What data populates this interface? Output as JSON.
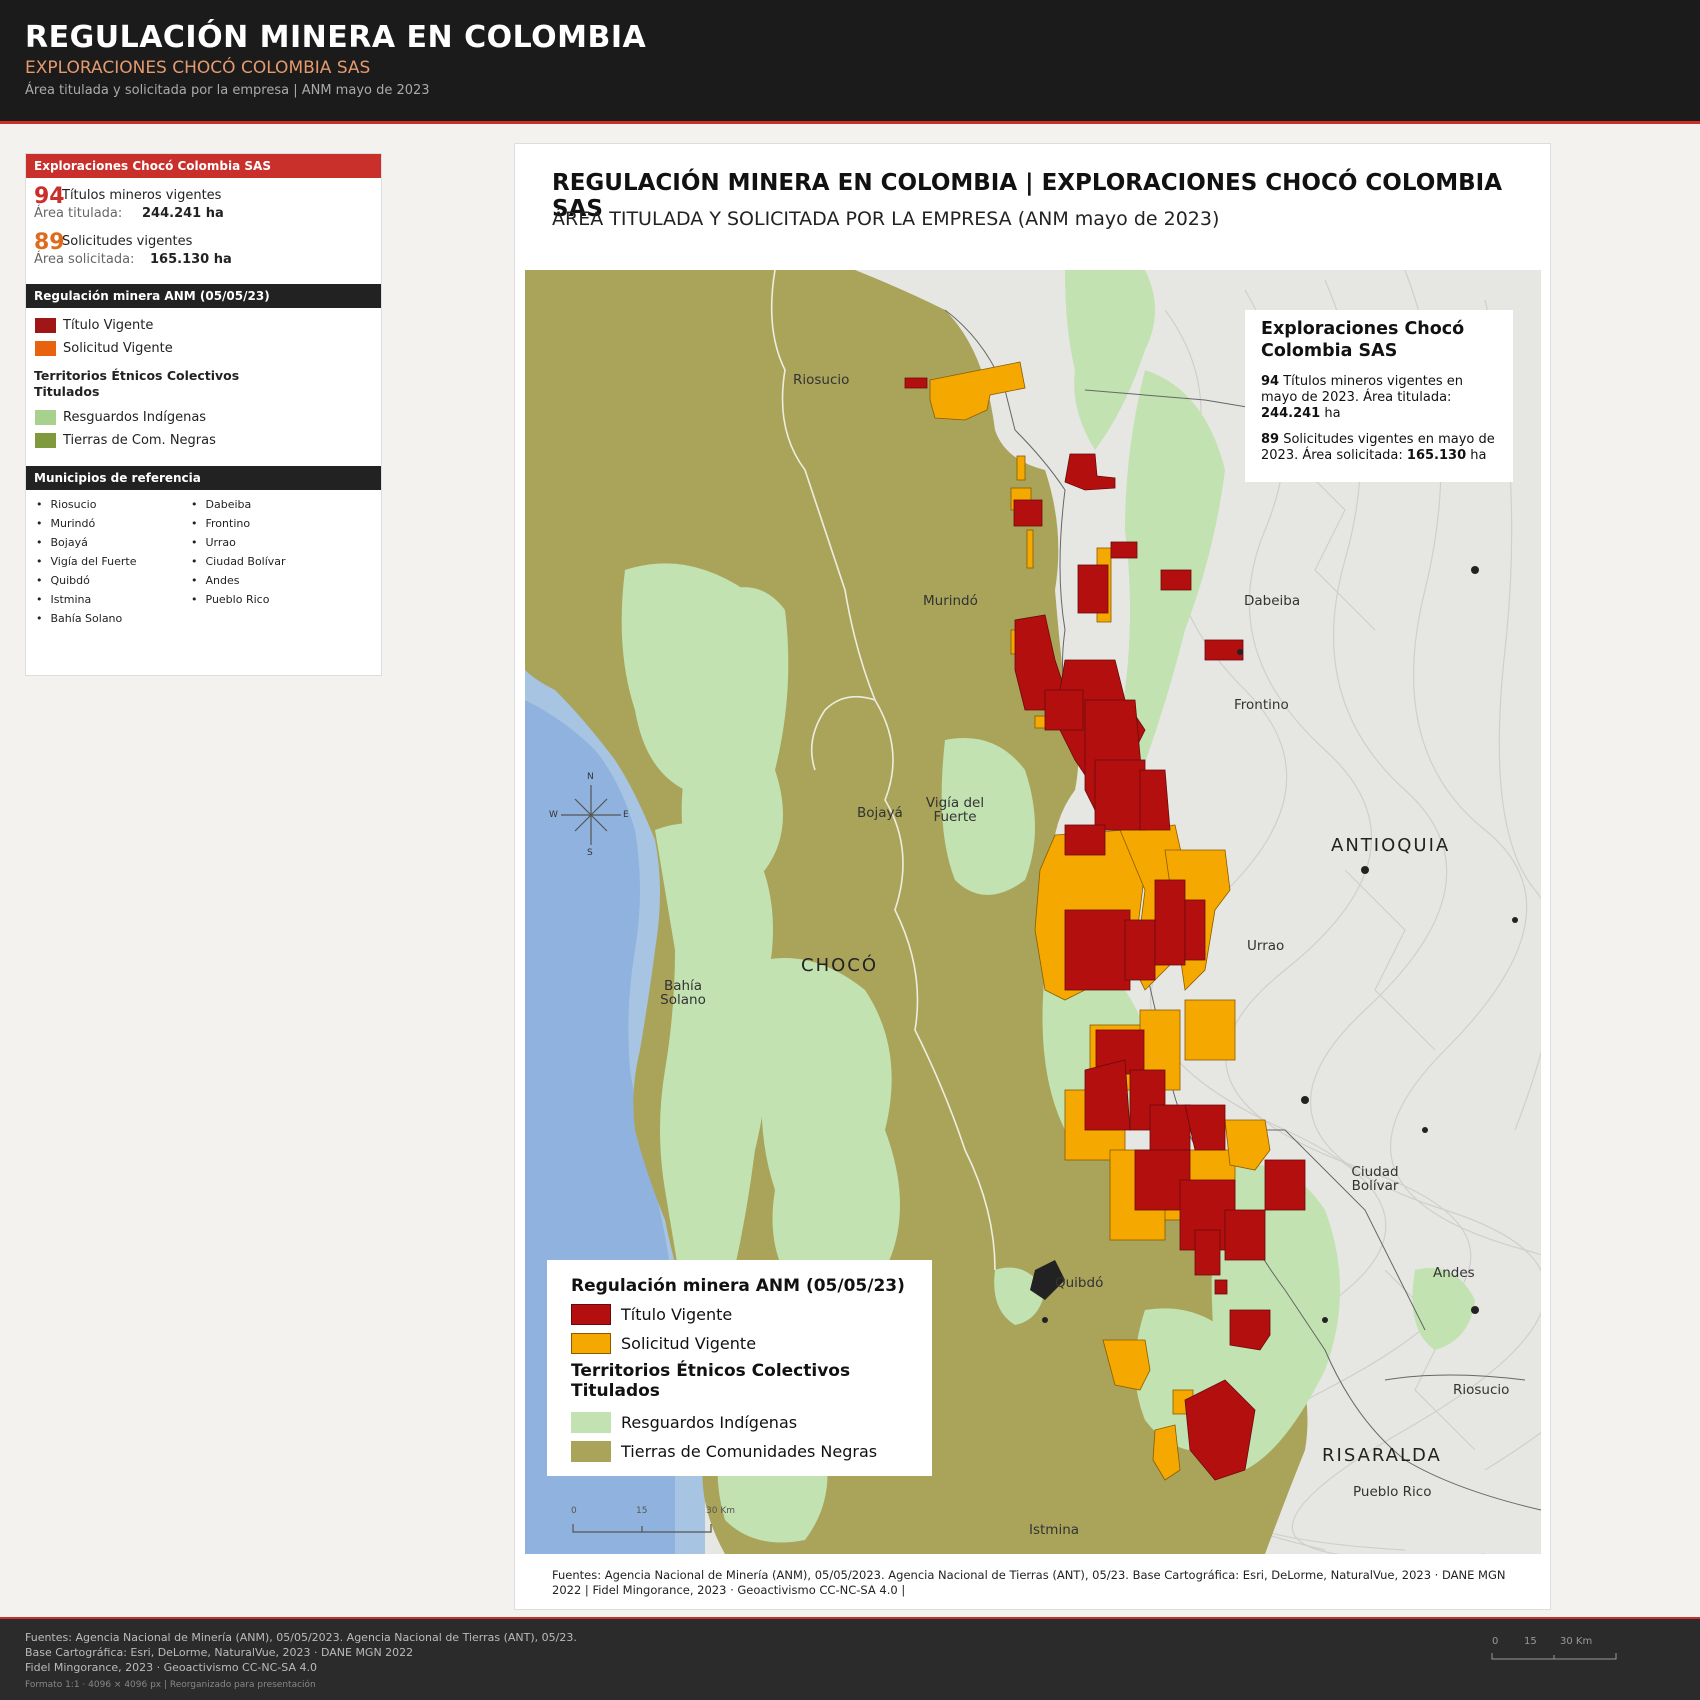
{
  "header": {
    "title": "REGULACIÓN MINERA EN COLOMBIA",
    "subtitle": "EXPLORACIONES CHOCÓ COLOMBIA SAS",
    "meta": "Área titulada y solicitada por la empresa  |  ANM mayo de 2023"
  },
  "sidebar": {
    "company_header": "Exploraciones Chocó Colombia SAS",
    "stats": [
      {
        "number": "94",
        "label": "Títulos mineros vigentes",
        "area_label": "Área titulada:",
        "area_value": "244.241 ha",
        "color": "#c9302c"
      },
      {
        "number": "89",
        "label": "Solicitudes vigentes",
        "area_label": "Área solicitada:",
        "area_value": "165.130 ha",
        "color": "#e06a1b"
      }
    ],
    "regulation_header": "Regulación minera ANM (05/05/23)",
    "regulation_items": [
      {
        "label": "Título Vigente",
        "color": "#a01515"
      },
      {
        "label": "Solicitud Vigente",
        "color": "#e8620f"
      }
    ],
    "ethnic_header": "Territorios Étnicos Colectivos Titulados",
    "ethnic_items": [
      {
        "label": "Resguardos Indígenas",
        "color": "#a9d18e"
      },
      {
        "label": "Tierras de Com. Negras",
        "color": "#7f9a3d"
      }
    ],
    "municipios_header": "Municipios de referencia",
    "municipios_col1": [
      "Riosucio",
      "Murindó",
      "Bojayá",
      "Vigía del Fuerte",
      "Quibdó",
      "Istmina",
      "Bahía Solano"
    ],
    "municipios_col2": [
      "Dabeiba",
      "Frontino",
      "Urrao",
      "Ciudad Bolívar",
      "Andes",
      "Pueblo Rico"
    ]
  },
  "map_card": {
    "title": "REGULACIÓN MINERA EN COLOMBIA | EXPLORACIONES CHOCÓ COLOMBIA SAS",
    "subtitle": "ÁREA TITULADA Y SOLICITADA POR LA EMPRESA (ANM mayo de 2023)",
    "info_box": {
      "title": "Exploraciones Chocó Colombia SAS",
      "p1_num": "94",
      "p1_text": " Títulos mineros vigentes en mayo de 2023. Área titulada: ",
      "p1_val": "244.241",
      "p1_unit": " ha",
      "p2_num": "89",
      "p2_text": " Solicitudes vigentes en mayo de 2023. Área solicitada: ",
      "p2_val": "165.130",
      "p2_unit": " ha"
    },
    "legend": {
      "title": "Regulación minera ANM (05/05/23)",
      "items": [
        {
          "label": "Título Vigente",
          "color": "#b30f0f"
        },
        {
          "label": "Solicitud Vigente",
          "color": "#f5a800"
        }
      ],
      "title2": "Territorios Étnicos Colectivos Titulados",
      "items2": [
        {
          "label": "Resguardos Indígenas",
          "color": "#c2e2b2"
        },
        {
          "label": "Tierras de Comunidades Negras",
          "color": "#a9a45a"
        }
      ]
    },
    "places": [
      "Riosucio",
      "Murindó",
      "Dabeiba",
      "Frontino",
      "Bojayá",
      "Vigía del Fuerte",
      "Urrao",
      "Bahía Solano",
      "Ciudad Bolívar",
      "Quibdó",
      "Andes",
      "Riosucio",
      "Pueblo Rico",
      "Istmina"
    ],
    "departments": [
      "CHOCÓ",
      "ANTIOQUIA",
      "RISARALDA"
    ],
    "compass": {
      "n": "N",
      "s": "S",
      "e": "E",
      "w": "W"
    },
    "scale": {
      "t0": "0",
      "t1": "15",
      "t2": "30 Km"
    },
    "sources": "Fuentes: Agencia Nacional de Minería (ANM), 05/05/2023. Agencia Nacional de Tierras (ANT), 05/23. Base Cartográfica: Esri, DeLorme, NaturalVue, 2023 · DANE MGN 2022 | Fidel Mingorance, 2023 · Geoactivismo CC-NC-SA 4.0 |"
  },
  "footer": {
    "line1": "Fuentes: Agencia Nacional de Minería (ANM), 05/05/2023. Agencia Nacional de Tierras (ANT), 05/23.",
    "line2": "Base Cartográfica: Esri, DeLorme, NaturalVue, 2023 · DANE MGN 2022",
    "line3": "Fidel Mingorance, 2023 · Geoactivismo CC-NC-SA 4.0",
    "line4": "Formato 1:1 · 4096 × 4096 px  |  Reorganizado para presentación",
    "scale": {
      "t0": "0",
      "t1": "15",
      "t2": "30 Km"
    }
  }
}
